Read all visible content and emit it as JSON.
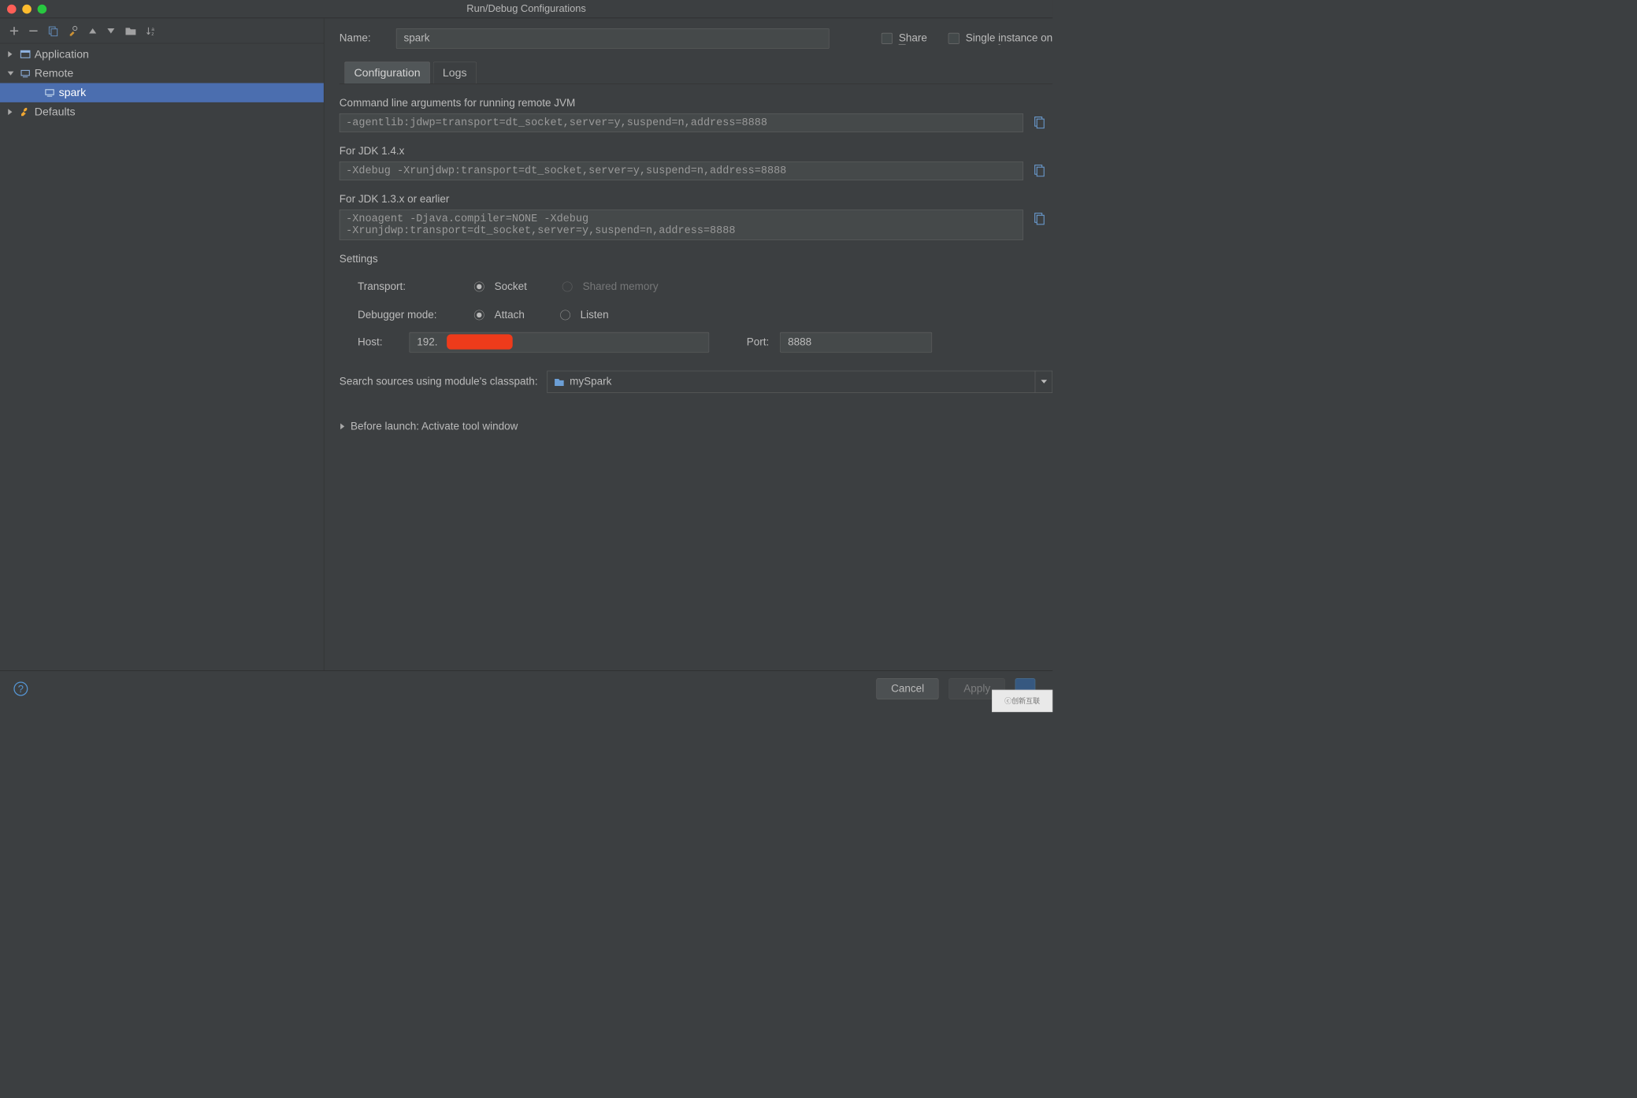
{
  "window": {
    "title": "Run/Debug Configurations"
  },
  "sidebar": {
    "items": [
      {
        "label": "Application",
        "expanded": false,
        "icon": "app"
      },
      {
        "label": "Remote",
        "expanded": true,
        "icon": "remote",
        "children": [
          {
            "label": "spark",
            "selected": true
          }
        ]
      },
      {
        "label": "Defaults",
        "expanded": false,
        "icon": "wrench"
      }
    ]
  },
  "header": {
    "name_label": "Name:",
    "name_value": "spark",
    "share_label": "Share",
    "single_label": "Single instance on"
  },
  "tabs": {
    "config": "Configuration",
    "logs": "Logs",
    "active": "config"
  },
  "remote": {
    "cmd_label": "Command line arguments for running remote JVM",
    "cmd_value": "-agentlib:jdwp=transport=dt_socket,server=y,suspend=n,address=8888",
    "jdk14_label": "For JDK 1.4.x",
    "jdk14_value": "-Xdebug -Xrunjdwp:transport=dt_socket,server=y,suspend=n,address=8888",
    "jdk13_label": "For JDK 1.3.x or earlier",
    "jdk13_value": "-Xnoagent -Djava.compiler=NONE -Xdebug\n-Xrunjdwp:transport=dt_socket,server=y,suspend=n,address=8888"
  },
  "settings": {
    "heading": "Settings",
    "transport_label": "Transport:",
    "transport_socket": "Socket",
    "transport_shared": "Shared memory",
    "mode_label": "Debugger mode:",
    "mode_attach": "Attach",
    "mode_listen": "Listen",
    "host_label": "Host:",
    "host_value": "192.",
    "port_label": "Port:",
    "port_value": "8888"
  },
  "module": {
    "label": "Search sources using module's classpath:",
    "value": "mySpark"
  },
  "before_launch": {
    "label": "Before launch: Activate tool window"
  },
  "buttons": {
    "cancel": "Cancel",
    "apply": "Apply"
  },
  "watermark": "创新互联"
}
